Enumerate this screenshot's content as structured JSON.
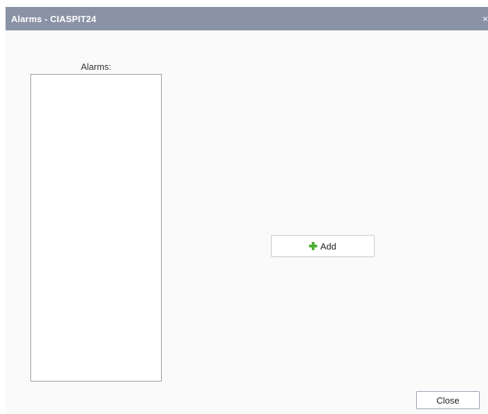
{
  "dialog": {
    "title": "Alarms - CIASPIT24",
    "close_glyph": "×",
    "list_label": "Alarms:",
    "alarms": [],
    "add_label": "Add",
    "add_icon": "plus-icon",
    "close_label": "Close"
  },
  "colors": {
    "titlebar": "#8a93a6",
    "add_icon": "#4caf36"
  }
}
